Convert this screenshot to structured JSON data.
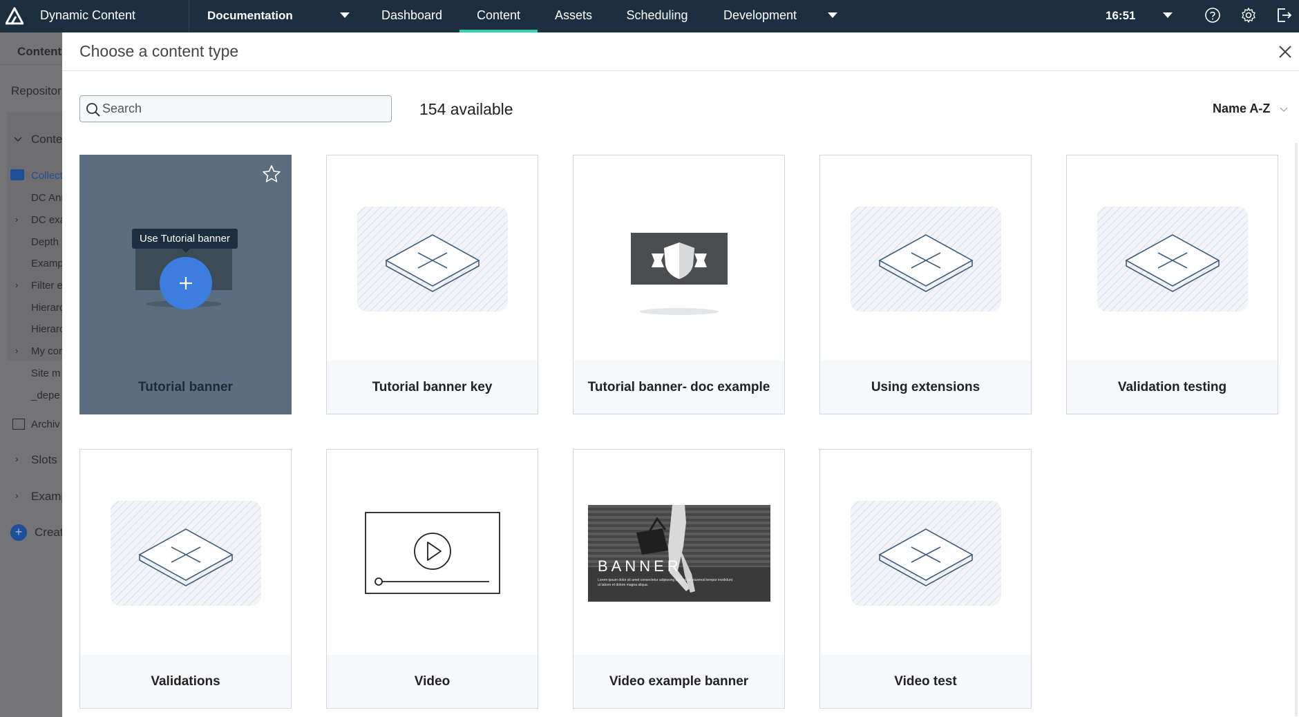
{
  "topbar": {
    "app_title": "Dynamic Content",
    "hub": "Documentation",
    "tabs": [
      {
        "label": "Dashboard",
        "active": false
      },
      {
        "label": "Content",
        "active": true
      },
      {
        "label": "Assets",
        "active": false
      },
      {
        "label": "Scheduling",
        "active": false
      },
      {
        "label": "Development",
        "active": false
      }
    ],
    "time": "16:51",
    "icons": [
      "help-icon",
      "settings-icon",
      "logout-icon"
    ],
    "colors": {
      "bar": "#1b2f40",
      "active_underline": "#2fd1b5"
    }
  },
  "background_sidebar": {
    "header": "Content",
    "repository": "Repositor",
    "section": "Conte",
    "items": [
      "Collect",
      "DC Ann",
      "DC exa",
      "Depth",
      "Examp",
      "Filter e",
      "Hierarc",
      "Hierarc",
      "My con",
      "Site m",
      "_depe",
      "Archiv",
      "Slots",
      "Examp",
      "Creat"
    ]
  },
  "modal": {
    "title": "Choose a content type",
    "search_placeholder": "Search",
    "available": "154 available",
    "sort": "Name A-Z",
    "hover_tooltip": "Use Tutorial banner",
    "cards": [
      {
        "label": "Tutorial banner",
        "image": "banner-hover"
      },
      {
        "label": "Tutorial banner key",
        "image": "placeholder"
      },
      {
        "label": "Tutorial banner- doc example",
        "image": "shield-banner"
      },
      {
        "label": "Using extensions",
        "image": "placeholder"
      },
      {
        "label": "Validation testing",
        "image": "placeholder"
      },
      {
        "label": "Validations",
        "image": "placeholder"
      },
      {
        "label": "Video",
        "image": "video-player"
      },
      {
        "label": "Video example banner",
        "image": "photo-banner"
      },
      {
        "label": "Video test",
        "image": "placeholder"
      }
    ],
    "photo_banner": {
      "heading": "BANNER",
      "body": "Lorem ipsum dolor sit amet consectetur adipiscing elit sed do eiusmod tempor incididunt ut labore et dolore magna aliqua."
    },
    "colors": {
      "accent": "#3c7ee0",
      "hover_card": "#5b6e7f"
    }
  }
}
